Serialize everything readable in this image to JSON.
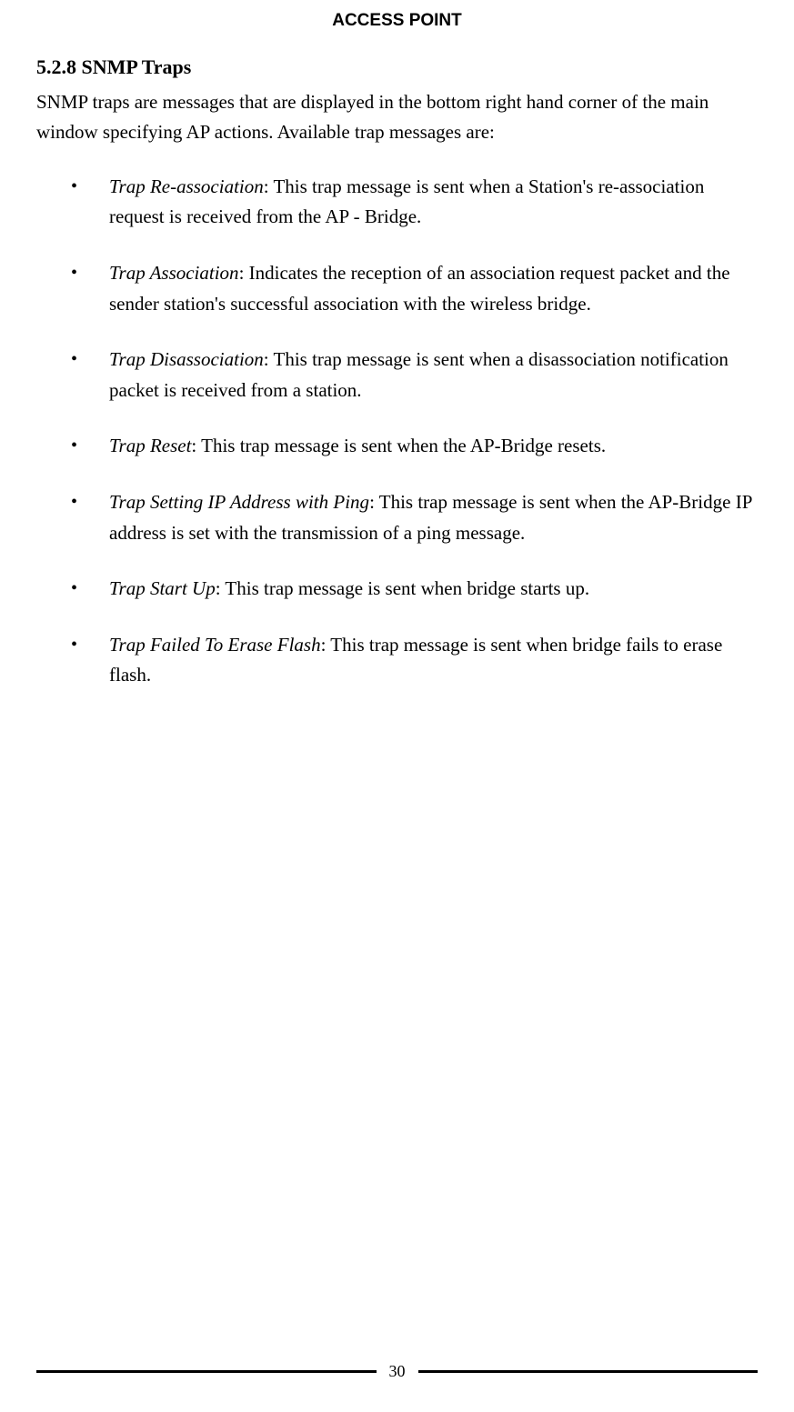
{
  "header": "ACCESS POINT",
  "section": {
    "number": "5.2.8",
    "title": "SNMP Traps"
  },
  "intro": "SNMP traps are messages that are displayed in the bottom right hand corner of the main window specifying AP actions. Available trap messages are:",
  "bullets": [
    {
      "term": "Trap Re-association",
      "desc": ": This trap message is sent when a Station's re-association request is received from the AP - Bridge."
    },
    {
      "term": "Trap Association",
      "desc": ": Indicates the reception of an association request packet and the sender station's successful association with the wireless bridge."
    },
    {
      "term": "Trap Disassociation",
      "desc": ": This trap message is sent when a disassociation notification packet is received from a station."
    },
    {
      "term": "Trap Reset",
      "desc": ": This trap message is sent when the AP-Bridge resets."
    },
    {
      "term": "Trap Setting IP Address with Ping",
      "desc": ": This trap message is sent when the AP-Bridge IP address is set with the transmission of a ping message."
    },
    {
      "term": "Trap Start Up",
      "desc": ": This trap message is sent when bridge starts up."
    },
    {
      "term": "Trap Failed To Erase Flash",
      "desc": ": This trap message is sent when bridge fails to erase flash."
    }
  ],
  "pageNumber": "30"
}
